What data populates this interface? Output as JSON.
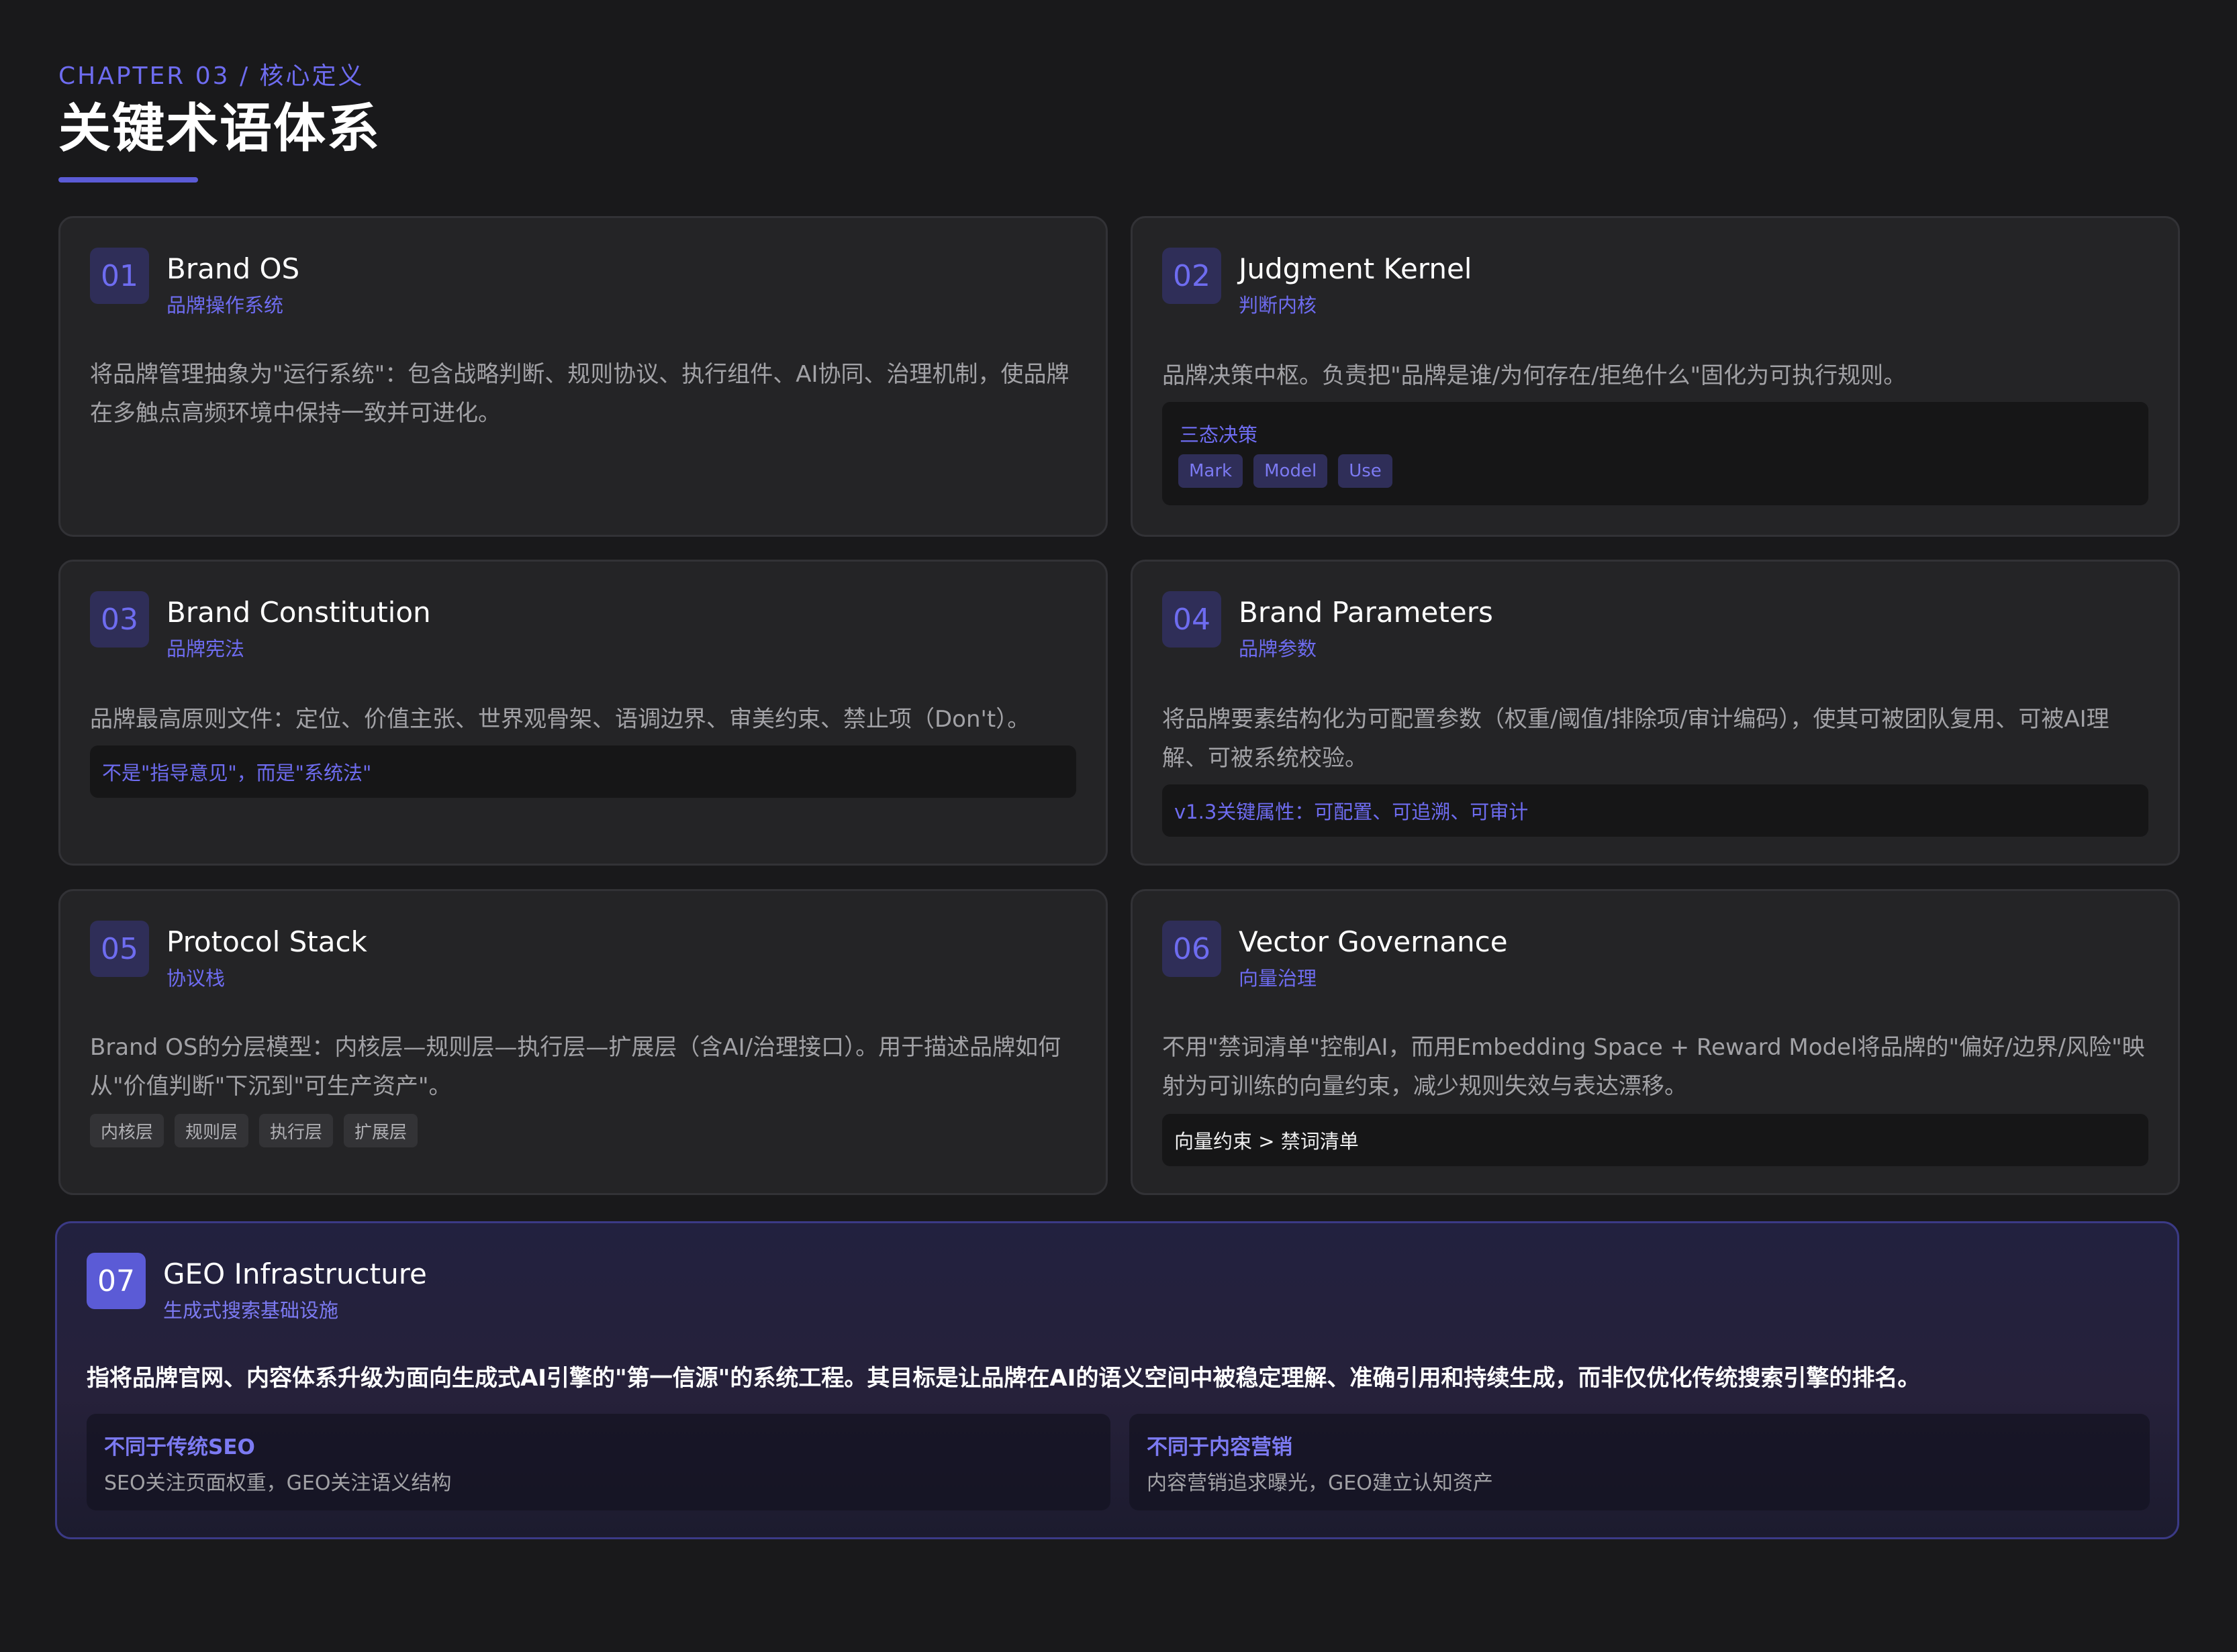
{
  "header": {
    "chapter": "CHAPTER 03 / 核心定义",
    "title": "关键术语体系"
  },
  "cards": [
    {
      "num": "01",
      "title": "Brand OS",
      "subtitle": "品牌操作系统",
      "description": "将品牌管理抽象为\"运行系统\"：包含战略判断、规则协议、执行组件、AI协同、治理机制，使品牌在多触点高频环境中保持一致并可进化。"
    },
    {
      "num": "02",
      "title": "Judgment Kernel",
      "subtitle": "判断内核",
      "description": "品牌决策中枢。负责把\"品牌是谁/为何存在/拒绝什么\"固化为可执行规则。",
      "box_label": "三态决策",
      "tags": [
        "Mark",
        "Model",
        "Use"
      ]
    },
    {
      "num": "03",
      "title": "Brand Constitution",
      "subtitle": "品牌宪法",
      "description": "品牌最高原则文件：定位、价值主张、世界观骨架、语调边界、审美约束、禁止项（Don't）。",
      "box_text": "不是\"指导意见\"，而是\"系统法\""
    },
    {
      "num": "04",
      "title": "Brand Parameters",
      "subtitle": "品牌参数",
      "description": "将品牌要素结构化为可配置参数（权重/阈值/排除项/审计编码），使其可被团队复用、可被AI理解、可被系统校验。",
      "box_text": "v1.3关键属性：可配置、可追溯、可审计"
    },
    {
      "num": "05",
      "title": "Protocol Stack",
      "subtitle": "协议栈",
      "description": "Brand OS的分层模型：内核层—规则层—执行层—扩展层（含AI/治理接口）。用于描述品牌如何从\"价值判断\"下沉到\"可生产资产\"。",
      "tags": [
        "内核层",
        "规则层",
        "执行层",
        "扩展层"
      ]
    },
    {
      "num": "06",
      "title": "Vector Governance",
      "subtitle": "向量治理",
      "description": "不用\"禁词清单\"控制AI，而用Embedding Space + Reward Model将品牌的\"偏好/边界/风险\"映射为可训练的向量约束，减少规则失效与表达漂移。",
      "box_text": "向量约束 > 禁词清单"
    }
  ],
  "feature": {
    "num": "07",
    "title": "GEO Infrastructure",
    "subtitle": "生成式搜索基础设施",
    "lead": "指将品牌官网、内容体系升级为面向生成式AI引擎的\"第一信源\"的系统工程。其目标是让品牌在AI的语义空间中被稳定理解、准确引用和持续生成，而非仅优化传统搜索引擎的排名。",
    "compare": [
      {
        "title": "不同于传统SEO",
        "text": "SEO关注页面权重，GEO关注语义结构"
      },
      {
        "title": "不同于内容营销",
        "text": "内容营销追求曝光，GEO建立认知资产"
      }
    ]
  },
  "colors": {
    "background": "#19191b",
    "card": "#242426",
    "accent": "#6e6cf0",
    "badge_bg": "#2f2e58"
  }
}
